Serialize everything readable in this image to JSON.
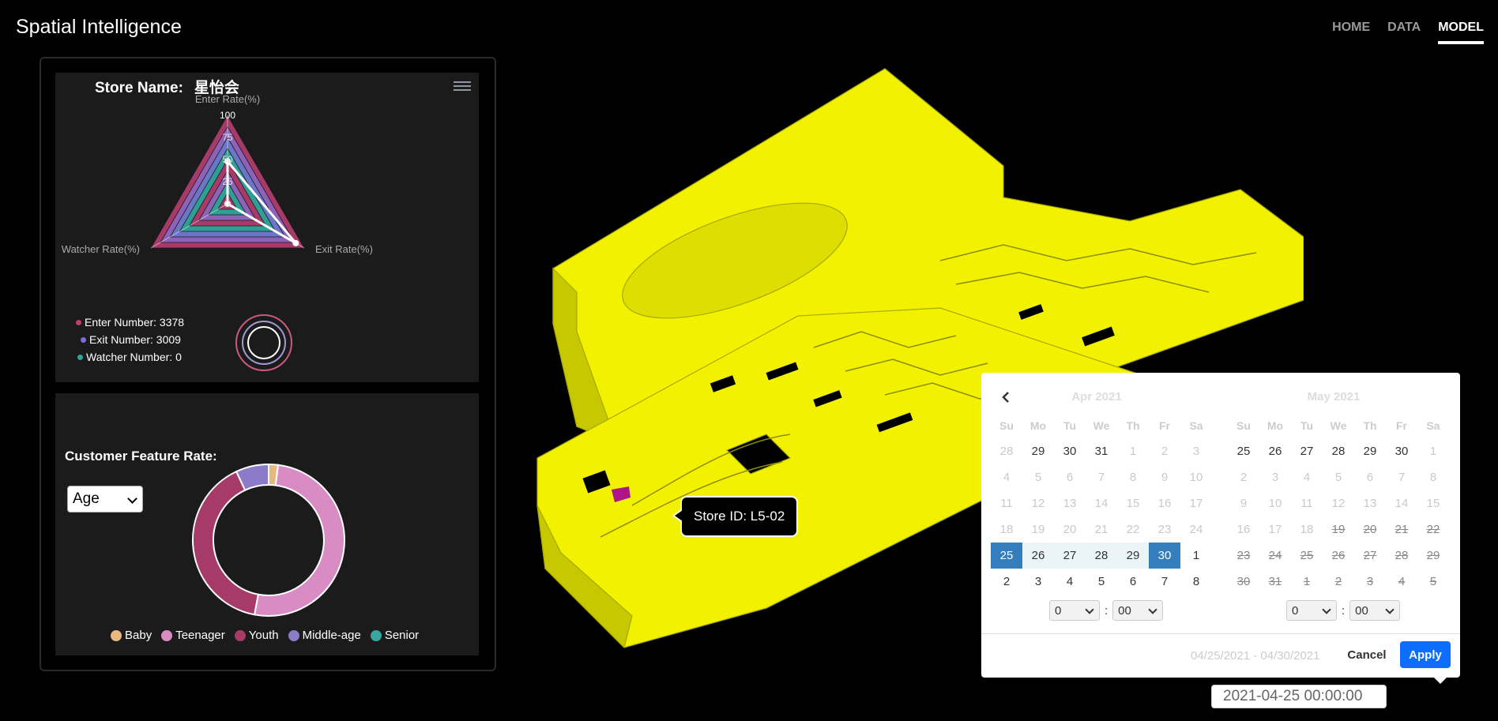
{
  "app": {
    "title": "Spatial Intelligence"
  },
  "nav": [
    {
      "label": "HOME",
      "active": false
    },
    {
      "label": "DATA",
      "active": false
    },
    {
      "label": "MODEL",
      "active": true
    }
  ],
  "store": {
    "name_label": "Store Name:",
    "name": "星怡会",
    "radar": {
      "indicators": [
        "Enter Rate(%)",
        "Exit Rate(%)",
        "Watcher Rate(%)"
      ],
      "scale_ticks": [
        "100",
        "75",
        "50",
        "25",
        "0"
      ],
      "max": 100,
      "values": {
        "Enter Rate(%)": 48,
        "Exit Rate(%)": 89,
        "Watcher Rate(%)": 0
      }
    },
    "legend": [
      {
        "label": "Enter Number: 3378",
        "color": "#c23a6e"
      },
      {
        "label": "Exit Number: 3009",
        "color": "#7b6fd6"
      },
      {
        "label": "Watcher Number: 0",
        "color": "#2fa69a"
      }
    ]
  },
  "customer_feature": {
    "label": "Customer Feature Rate:",
    "select_value": "Age",
    "donut": [
      {
        "name": "Baby",
        "value": 2,
        "color": "#e6b980"
      },
      {
        "name": "Teenager",
        "value": 51,
        "color": "#d98bc4"
      },
      {
        "name": "Youth",
        "value": 40,
        "color": "#a63b6a"
      },
      {
        "name": "Middle-age",
        "value": 7,
        "color": "#8b7bc8"
      },
      {
        "name": "Senior",
        "value": 0,
        "color": "#35a6a0"
      }
    ]
  },
  "model": {
    "tooltip": "Store ID: L5-02",
    "fill_color": "#f2f200"
  },
  "datepicker": {
    "months": [
      "Apr 2021",
      "May 2021"
    ],
    "weekdays": [
      "Su",
      "Mo",
      "Tu",
      "We",
      "Th",
      "Fr",
      "Sa"
    ],
    "left_days": [
      [
        "28",
        "off"
      ],
      [
        "29",
        "norm"
      ],
      [
        "30",
        "norm"
      ],
      [
        "31",
        "norm"
      ],
      [
        "1",
        "off"
      ],
      [
        "2",
        "off"
      ],
      [
        "3",
        "off"
      ],
      [
        "4",
        "off"
      ],
      [
        "5",
        "off"
      ],
      [
        "6",
        "off"
      ],
      [
        "7",
        "off"
      ],
      [
        "8",
        "off"
      ],
      [
        "9",
        "off"
      ],
      [
        "10",
        "off"
      ],
      [
        "11",
        "off"
      ],
      [
        "12",
        "off"
      ],
      [
        "13",
        "off"
      ],
      [
        "14",
        "off"
      ],
      [
        "15",
        "off"
      ],
      [
        "16",
        "off"
      ],
      [
        "17",
        "off"
      ],
      [
        "18",
        "off"
      ],
      [
        "19",
        "off"
      ],
      [
        "20",
        "off"
      ],
      [
        "21",
        "off"
      ],
      [
        "22",
        "off"
      ],
      [
        "23",
        "off"
      ],
      [
        "24",
        "off"
      ],
      [
        "25",
        "sel"
      ],
      [
        "26",
        "in"
      ],
      [
        "27",
        "in"
      ],
      [
        "28",
        "in"
      ],
      [
        "29",
        "in"
      ],
      [
        "30",
        "sel"
      ],
      [
        "1",
        "norm"
      ],
      [
        "2",
        "norm"
      ],
      [
        "3",
        "norm"
      ],
      [
        "4",
        "norm"
      ],
      [
        "5",
        "norm"
      ],
      [
        "6",
        "norm"
      ],
      [
        "7",
        "norm"
      ],
      [
        "8",
        "norm"
      ]
    ],
    "right_days": [
      [
        "25",
        "norm"
      ],
      [
        "26",
        "norm"
      ],
      [
        "27",
        "norm"
      ],
      [
        "28",
        "norm"
      ],
      [
        "29",
        "norm"
      ],
      [
        "30",
        "norm"
      ],
      [
        "1",
        "off"
      ],
      [
        "2",
        "off"
      ],
      [
        "3",
        "off"
      ],
      [
        "4",
        "off"
      ],
      [
        "5",
        "off"
      ],
      [
        "6",
        "off"
      ],
      [
        "7",
        "off"
      ],
      [
        "8",
        "off"
      ],
      [
        "9",
        "off"
      ],
      [
        "10",
        "off"
      ],
      [
        "11",
        "off"
      ],
      [
        "12",
        "off"
      ],
      [
        "13",
        "off"
      ],
      [
        "14",
        "off"
      ],
      [
        "15",
        "off"
      ],
      [
        "16",
        "off"
      ],
      [
        "17",
        "off"
      ],
      [
        "18",
        "off"
      ],
      [
        "19",
        "strike"
      ],
      [
        "20",
        "strike"
      ],
      [
        "21",
        "strike"
      ],
      [
        "22",
        "strike"
      ],
      [
        "23",
        "strike"
      ],
      [
        "24",
        "strike"
      ],
      [
        "25",
        "strike"
      ],
      [
        "26",
        "strike"
      ],
      [
        "27",
        "strike"
      ],
      [
        "28",
        "strike"
      ],
      [
        "29",
        "strike"
      ],
      [
        "30",
        "strike"
      ],
      [
        "31",
        "strike"
      ],
      [
        "1",
        "strike"
      ],
      [
        "2",
        "strike"
      ],
      [
        "3",
        "strike"
      ],
      [
        "4",
        "strike"
      ],
      [
        "5",
        "strike"
      ]
    ],
    "left_time": {
      "hour": "0",
      "minute": "00"
    },
    "right_time": {
      "hour": "0",
      "minute": "00"
    },
    "time_separator": ":",
    "range_text": "04/25/2021 - 04/30/2021",
    "cancel_label": "Cancel",
    "apply_label": "Apply"
  },
  "date_input": {
    "value": "2021-04-25 00:00:00"
  }
}
